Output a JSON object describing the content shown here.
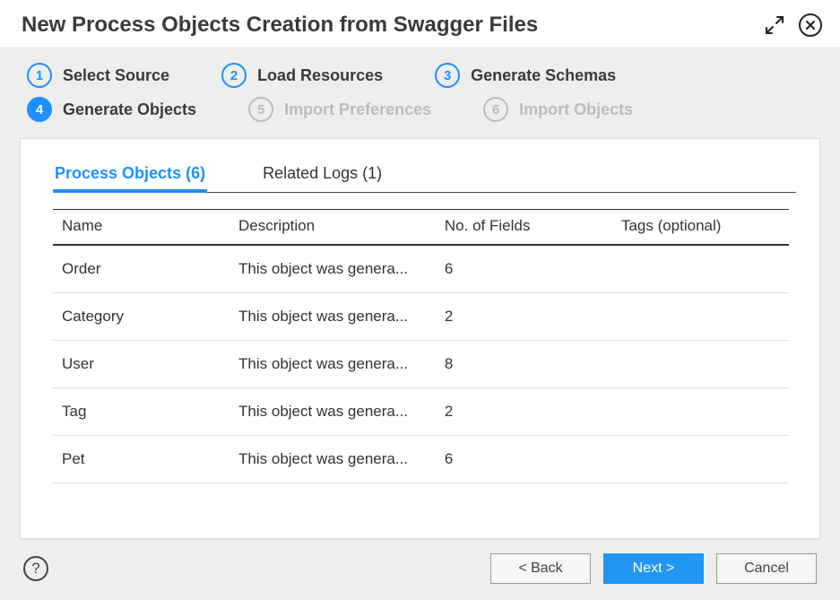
{
  "title": "New Process Objects Creation from Swagger Files",
  "stepper": [
    {
      "num": "1",
      "label": "Select Source",
      "state": "done"
    },
    {
      "num": "2",
      "label": "Load Resources",
      "state": "done"
    },
    {
      "num": "3",
      "label": "Generate Schemas",
      "state": "done"
    },
    {
      "num": "4",
      "label": "Generate Objects",
      "state": "active"
    },
    {
      "num": "5",
      "label": "Import Preferences",
      "state": "disabled"
    },
    {
      "num": "6",
      "label": "Import Objects",
      "state": "disabled"
    }
  ],
  "tabs": {
    "process_objects": "Process Objects (6)",
    "related_logs": "Related Logs (1)"
  },
  "columns": {
    "name": "Name",
    "description": "Description",
    "fields": "No. of Fields",
    "tags": "Tags (optional)"
  },
  "rows": [
    {
      "name": "Order",
      "description": "This object was genera...",
      "fields": "6",
      "tags": ""
    },
    {
      "name": "Category",
      "description": "This object was genera...",
      "fields": "2",
      "tags": ""
    },
    {
      "name": "User",
      "description": "This object was genera...",
      "fields": "8",
      "tags": ""
    },
    {
      "name": "Tag",
      "description": "This object was genera...",
      "fields": "2",
      "tags": ""
    },
    {
      "name": "Pet",
      "description": "This object was genera...",
      "fields": "6",
      "tags": ""
    }
  ],
  "buttons": {
    "back": "< Back",
    "next": "Next >",
    "cancel": "Cancel"
  },
  "help": "?"
}
